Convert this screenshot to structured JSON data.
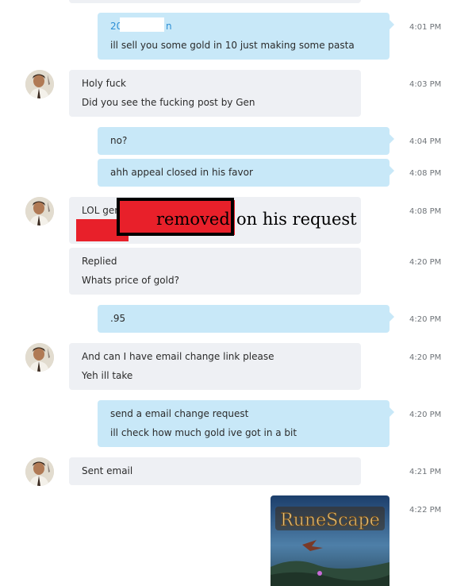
{
  "conversation": {
    "messages": [
      {
        "id": "m1",
        "direction": "outgoing",
        "sender_visible": "20",
        "sender_end": "n",
        "lines": [
          "ill sell you some gold in 10 just making some pasta"
        ],
        "time": "4:01 PM"
      },
      {
        "id": "m2",
        "direction": "incoming",
        "lines": [
          "Holy fuck",
          "Did you see the fucking post by Gen"
        ],
        "time": "4:03 PM"
      },
      {
        "id": "m3",
        "direction": "outgoing",
        "lines": [
          "no?"
        ],
        "time": "4:04 PM"
      },
      {
        "id": "m4",
        "direction": "outgoing",
        "lines": [
          "ahh appeal closed in his favor"
        ],
        "time": "4:08 PM"
      },
      {
        "id": "m5",
        "direction": "incoming",
        "lines": [
          "LOL gen"
        ],
        "time": "4:08 PM",
        "overlay": {
          "word1": "removed",
          "word2": "on his request"
        }
      },
      {
        "id": "m6",
        "direction": "incoming",
        "lines": [
          "Replied",
          "Whats price of gold?"
        ],
        "time": "4:20 PM"
      },
      {
        "id": "m7",
        "direction": "outgoing",
        "lines": [
          ".95"
        ],
        "time": "4:20 PM"
      },
      {
        "id": "m8",
        "direction": "incoming",
        "lines": [
          "And can I have email change link please",
          "Yeh ill take"
        ],
        "time": "4:20 PM"
      },
      {
        "id": "m9",
        "direction": "outgoing",
        "lines": [
          "send a email change request",
          "ill check how much gold ive got in a bit"
        ],
        "time": "4:20 PM"
      },
      {
        "id": "m10",
        "direction": "incoming",
        "lines": [
          "Sent email"
        ],
        "time": "4:21 PM"
      },
      {
        "id": "m11",
        "direction": "outgoing",
        "type": "image",
        "image_logo": "RuneScape",
        "time": "4:22 PM"
      }
    ]
  },
  "colors": {
    "incoming_bubble": "#eef0f4",
    "outgoing_bubble": "#c8e8f8",
    "sender_name": "#2d8fd5",
    "timestamp": "#6e7378",
    "redaction_red": "#e8202a"
  },
  "icons": {
    "avatar": "person-avatar-icon"
  }
}
